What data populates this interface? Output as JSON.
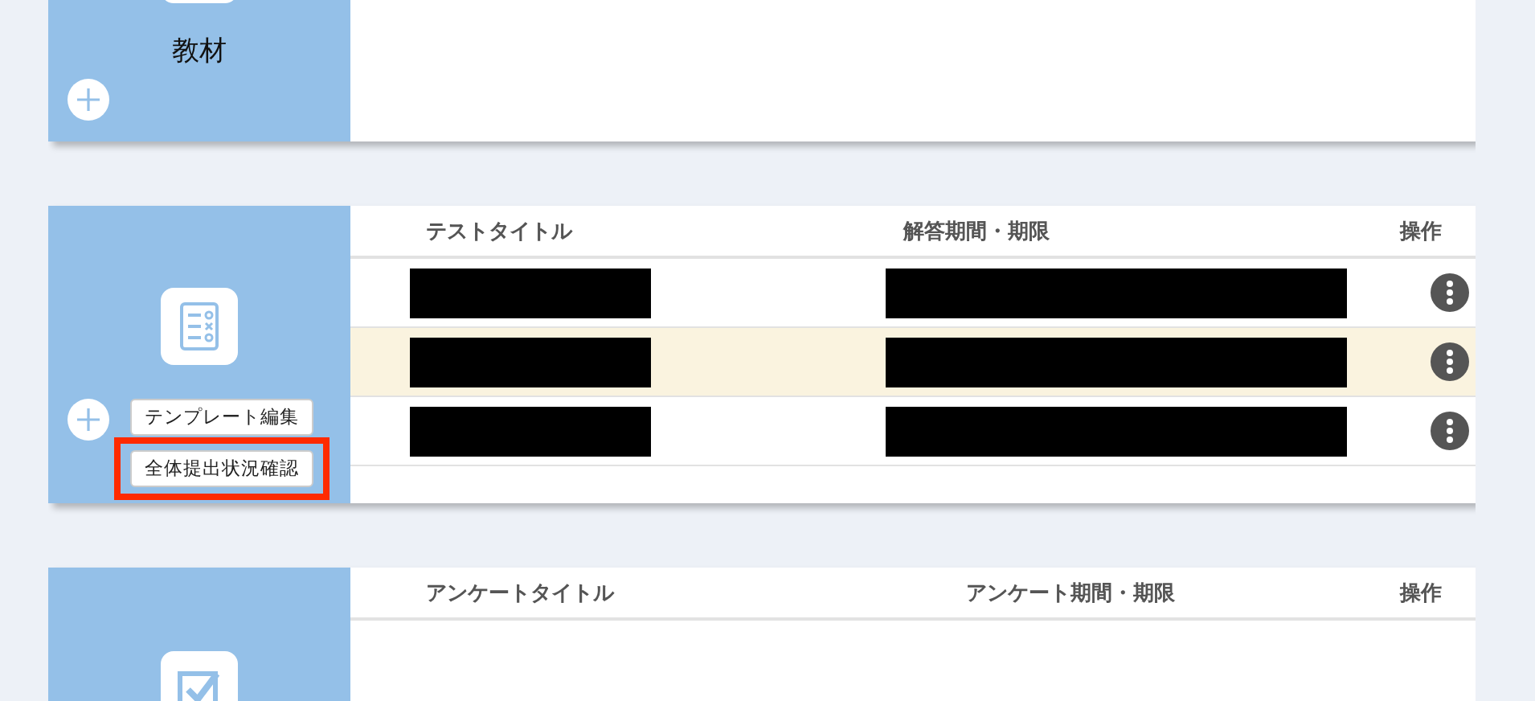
{
  "sections": [
    {
      "kind": "materials",
      "label": "教材"
    },
    {
      "kind": "tests",
      "columns": [
        "テストタイトル",
        "解答期間・期限",
        "操作"
      ],
      "rows": [
        {
          "redacted": true,
          "highlighted": false
        },
        {
          "redacted": true,
          "highlighted": true
        },
        {
          "redacted": true,
          "highlighted": false
        }
      ],
      "menu": [
        {
          "label": "テンプレート編集",
          "highlighted": false
        },
        {
          "label": "全体提出状況確認",
          "highlighted": true
        }
      ]
    },
    {
      "kind": "surveys",
      "columns": [
        "アンケートタイトル",
        "アンケート期間・期限",
        "操作"
      ]
    }
  ]
}
